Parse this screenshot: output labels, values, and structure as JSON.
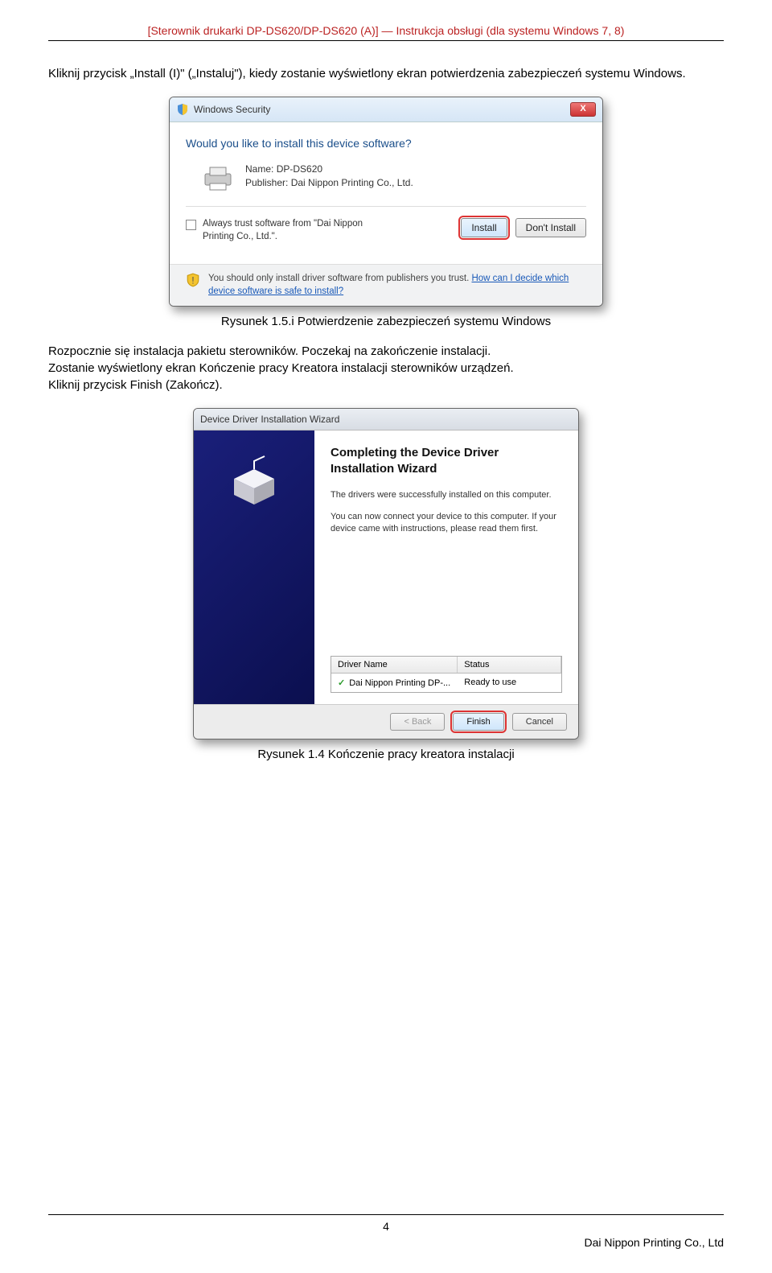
{
  "header": "[Sterownik drukarki DP-DS620/DP-DS620 (A)] — Instrukcja obsługi (dla systemu Windows 7, 8)",
  "para1": "Kliknij przycisk „Install (I)\" („Instaluj\"), kiedy zostanie wyświetlony ekran potwierdzenia zabezpieczeń systemu Windows.",
  "caption1": "Rysunek 1.5.i Potwierdzenie zabezpieczeń systemu Windows",
  "para2a": "Rozpocznie się instalacja pakietu sterowników. Poczekaj na zakończenie instalacji.",
  "para2b": "Zostanie wyświetlony ekran Kończenie pracy Kreatora instalacji sterowników urządzeń.",
  "para2c": "Kliknij przycisk Finish (Zakończ).",
  "caption2": "Rysunek 1.4 Kończenie pracy kreatora instalacji",
  "winsec": {
    "title": "Windows Security",
    "close": "X",
    "question": "Would you like to install this device software?",
    "name_label": "Name:",
    "name_value": "DP-DS620",
    "publisher_label": "Publisher:",
    "publisher_value": "Dai Nippon Printing Co., Ltd.",
    "trust_label": "Always trust software from \"Dai Nippon Printing Co., Ltd.\".",
    "install_btn": "Install",
    "dont_install_btn": "Don't Install",
    "footer_text": "You should only install driver software from publishers you trust. ",
    "footer_link": "How can I decide which device software is safe to install?"
  },
  "wizard": {
    "title": "Device Driver Installation Wizard",
    "heading": "Completing the Device Driver Installation Wizard",
    "line1": "The drivers were successfully installed on this computer.",
    "line2": "You can now connect your device to this computer. If your device came with instructions, please read them first.",
    "col_driver": "Driver Name",
    "col_status": "Status",
    "row_driver": "Dai Nippon Printing DP-...",
    "row_status": "Ready to use",
    "back_btn": "< Back",
    "finish_btn": "Finish",
    "cancel_btn": "Cancel"
  },
  "page_number": "4",
  "company": "Dai Nippon Printing Co., Ltd"
}
